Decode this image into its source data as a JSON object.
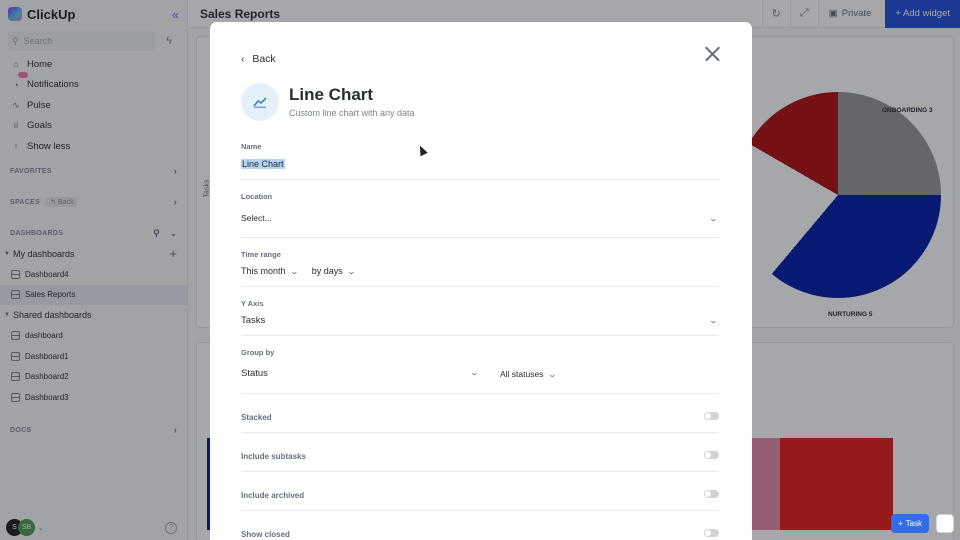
{
  "app": {
    "name": "ClickUp"
  },
  "sidebar": {
    "search_placeholder": "Search",
    "nav": [
      {
        "label": "Home"
      },
      {
        "label": "Notifications"
      },
      {
        "label": "Pulse"
      },
      {
        "label": "Goals"
      },
      {
        "label": "Show less"
      }
    ],
    "sections": {
      "favorites": "FAVORITES",
      "spaces": "SPACES",
      "spaces_back": "Back",
      "dashboards": "DASHBOARDS",
      "docs": "DOCS"
    },
    "my_dashboards": {
      "label": "My dashboards",
      "items": [
        "Dashboard4",
        "Sales Reports"
      ]
    },
    "shared_dashboards": {
      "label": "Shared dashboards",
      "items": [
        "dashboard",
        "Dashboard1",
        "Dashboard2",
        "Dashboard3"
      ]
    },
    "avatars": [
      "S",
      "SB"
    ]
  },
  "topbar": {
    "title": "Sales Reports",
    "private_label": "Private",
    "add_widget_label": "+ Add widget"
  },
  "background_chart": {
    "labels": [
      "ONBOARDING 3",
      "NURTURING 5"
    ],
    "y_axis": "Tasks"
  },
  "modal": {
    "back_label": "Back",
    "title": "Line Chart",
    "subtitle": "Custom line chart with any data",
    "fields": {
      "name": {
        "label": "Name",
        "value": "Line Chart"
      },
      "location": {
        "label": "Location",
        "value": "Select..."
      },
      "time_range": {
        "label": "Time range",
        "value": "This month",
        "granularity": "by days"
      },
      "y_axis": {
        "label": "Y Axis",
        "value": "Tasks"
      },
      "group_by": {
        "label": "Group by",
        "value": "Status",
        "filter": "All statuses"
      }
    },
    "toggles": [
      {
        "label": "Stacked",
        "on": false
      },
      {
        "label": "Include subtasks",
        "on": false
      },
      {
        "label": "Include archived",
        "on": false
      },
      {
        "label": "Show closed",
        "on": false
      }
    ]
  },
  "floating": {
    "task_label": "Task"
  },
  "colors": {
    "accent": "#7b68ee",
    "add_widget": "#1d4ed8",
    "selection": "#b4d2f4"
  }
}
